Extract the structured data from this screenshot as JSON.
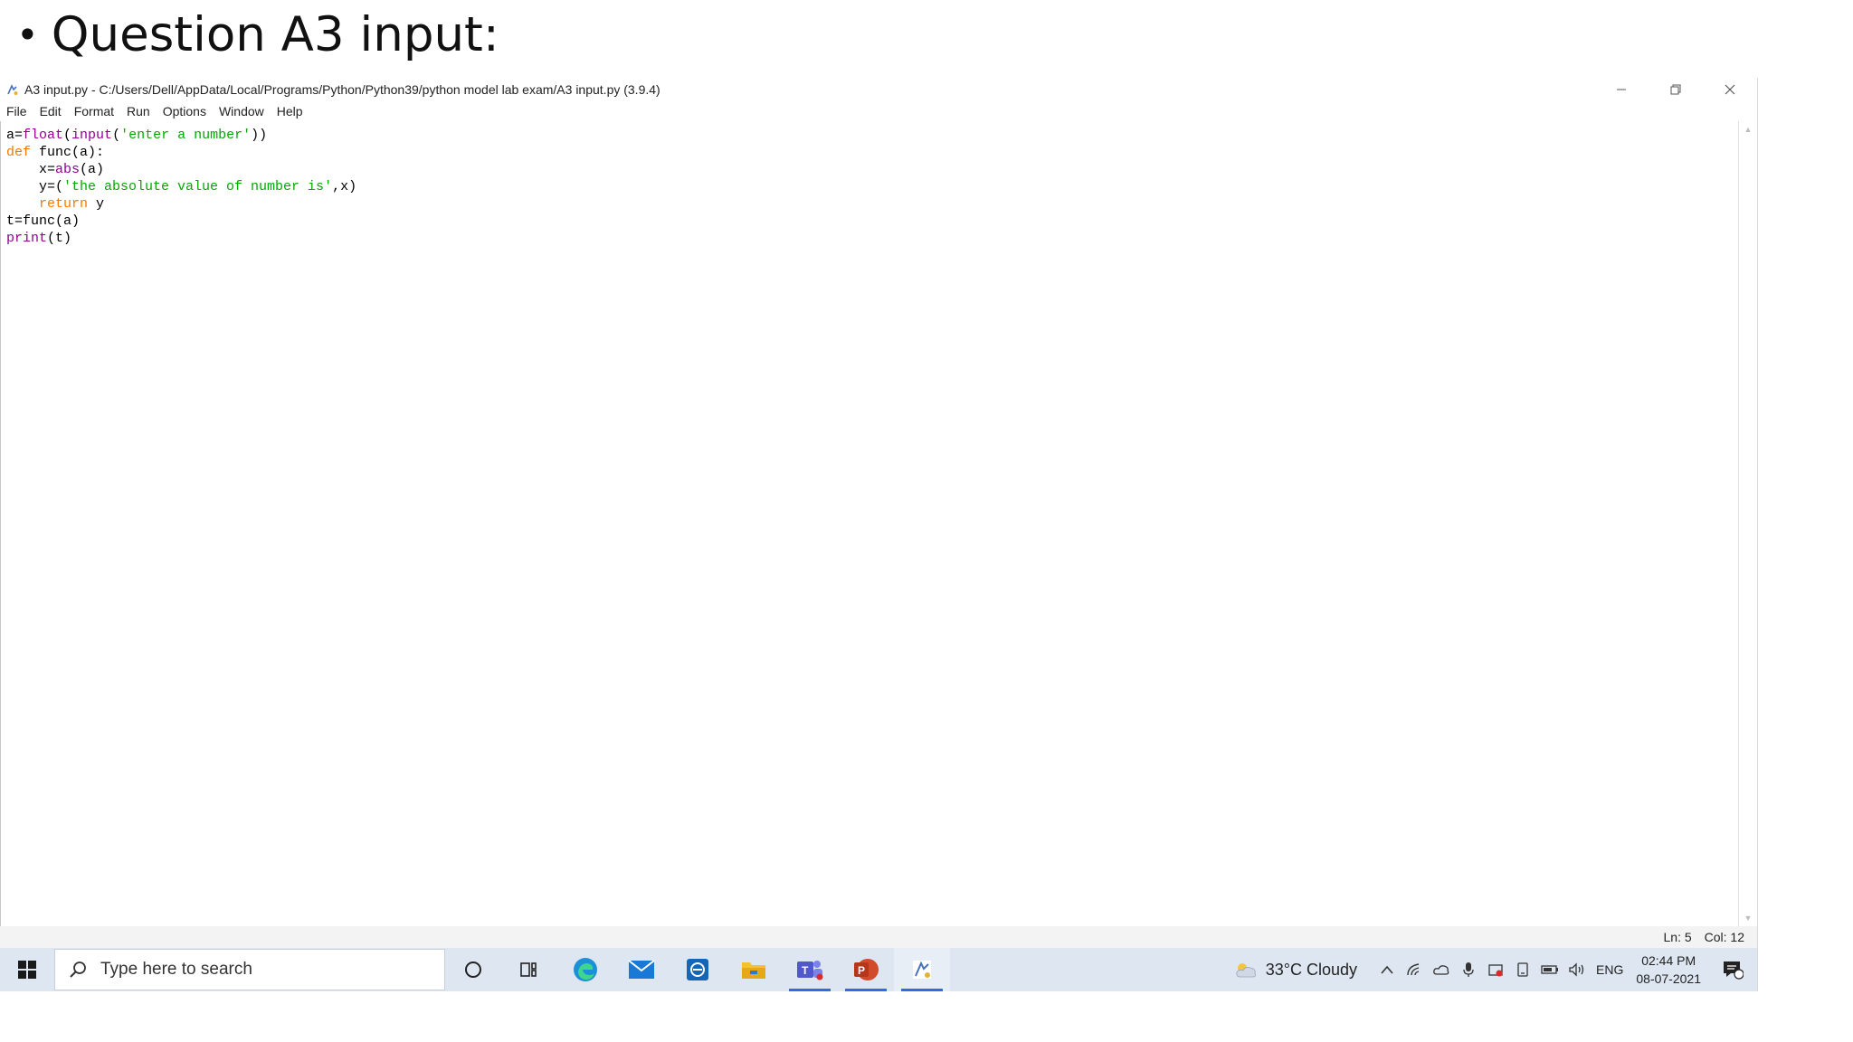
{
  "slide": {
    "bullet": "•",
    "heading": "Question A3 input:"
  },
  "window": {
    "title": "A3 input.py - C:/Users/Dell/AppData/Local/Programs/Python/Python39/python model lab exam/A3 input.py (3.9.4)",
    "controls": [
      "minimize",
      "restore",
      "close"
    ]
  },
  "menu": [
    "File",
    "Edit",
    "Format",
    "Run",
    "Options",
    "Window",
    "Help"
  ],
  "code": {
    "line1": {
      "a": "a=",
      "b": "float",
      "c": "(",
      "d": "input",
      "e": "(",
      "f": "'enter a number'",
      "g": "))"
    },
    "line2": {
      "a": "def",
      "b": " func(a):"
    },
    "line3": {
      "a": "    x=",
      "b": "abs",
      "c": "(a)"
    },
    "line4": {
      "a": "    y=(",
      "b": "'the absolute value of number is'",
      "c": ",x)"
    },
    "line5": {
      "a": "    ",
      "b": "return",
      "c": " y"
    },
    "line6": {
      "a": "t=func(a)"
    },
    "line7": {
      "a": "print",
      "b": "(t)"
    }
  },
  "status": {
    "ln": "Ln: 5",
    "col": "Col: 12"
  },
  "taskbar": {
    "search_placeholder": "Type here to search",
    "weather": "33°C  Cloudy",
    "lang": "ENG",
    "time": "02:44 PM",
    "date": "08-07-2021"
  },
  "colors": {
    "keyword": "#ff7700",
    "builtin": "#900090",
    "string": "#00aa00",
    "taskbar": "#dde6f1",
    "active_indicator": "#2a6fdb"
  }
}
